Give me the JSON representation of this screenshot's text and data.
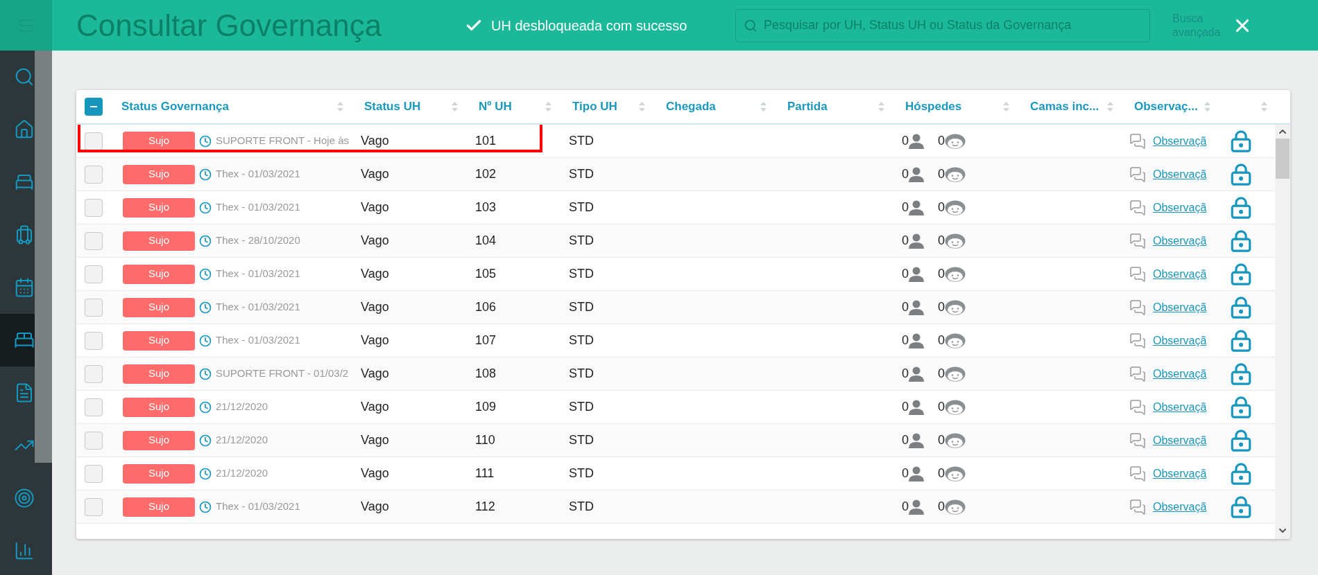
{
  "app_bar": {
    "title": "Consultar Governança",
    "search": {
      "placeholder": "Pesquisar por UH, Status UH ou Status da Governança"
    },
    "advanced_search": "Busca avançada"
  },
  "toast": {
    "message": "UH desbloqueada com sucesso"
  },
  "sidebar": {
    "items": [
      {
        "selected": false
      },
      {
        "selected": false
      },
      {
        "selected": false
      },
      {
        "selected": false
      },
      {
        "selected": false
      },
      {
        "selected": true
      },
      {
        "selected": false
      },
      {
        "selected": false
      },
      {
        "selected": false
      },
      {
        "selected": false
      }
    ]
  },
  "table": {
    "select_all": {
      "indeterminate": true
    },
    "columns": [
      "Status Governança",
      "Status UH",
      "Nº UH",
      "Tipo UH",
      "Chegada",
      "Partida",
      "Hóspedes",
      "Camas inc...",
      "Observaç..."
    ],
    "rows": [
      {
        "checked": false,
        "highlighted": true,
        "status": "Sujo",
        "note": "SUPORTE FRONT - Hoje às",
        "uh_status": "Vago",
        "number": "101",
        "type": "STD",
        "adults": "0",
        "children": "0",
        "observation": "Observaçã",
        "locked": true
      },
      {
        "checked": false,
        "highlighted": false,
        "status": "Sujo",
        "note": "Thex - 01/03/2021",
        "uh_status": "Vago",
        "number": "102",
        "type": "STD",
        "adults": "0",
        "children": "0",
        "observation": "Observaçã",
        "locked": true
      },
      {
        "checked": false,
        "highlighted": false,
        "status": "Sujo",
        "note": "Thex - 01/03/2021",
        "uh_status": "Vago",
        "number": "103",
        "type": "STD",
        "adults": "0",
        "children": "0",
        "observation": "Observaçã",
        "locked": true
      },
      {
        "checked": false,
        "highlighted": false,
        "status": "Sujo",
        "note": "Thex - 28/10/2020",
        "uh_status": "Vago",
        "number": "104",
        "type": "STD",
        "adults": "0",
        "children": "0",
        "observation": "Observaçã",
        "locked": true
      },
      {
        "checked": false,
        "highlighted": false,
        "status": "Sujo",
        "note": "Thex - 01/03/2021",
        "uh_status": "Vago",
        "number": "105",
        "type": "STD",
        "adults": "0",
        "children": "0",
        "observation": "Observaçã",
        "locked": true
      },
      {
        "checked": false,
        "highlighted": false,
        "status": "Sujo",
        "note": "Thex - 01/03/2021",
        "uh_status": "Vago",
        "number": "106",
        "type": "STD",
        "adults": "0",
        "children": "0",
        "observation": "Observaçã",
        "locked": true
      },
      {
        "checked": false,
        "highlighted": false,
        "status": "Sujo",
        "note": "Thex - 01/03/2021",
        "uh_status": "Vago",
        "number": "107",
        "type": "STD",
        "adults": "0",
        "children": "0",
        "observation": "Observaçã",
        "locked": true
      },
      {
        "checked": false,
        "highlighted": false,
        "status": "Sujo",
        "note": "SUPORTE FRONT - 01/03/2",
        "uh_status": "Vago",
        "number": "108",
        "type": "STD",
        "adults": "0",
        "children": "0",
        "observation": "Observaçã",
        "locked": true
      },
      {
        "checked": false,
        "highlighted": false,
        "status": "Sujo",
        "note": "21/12/2020",
        "uh_status": "Vago",
        "number": "109",
        "type": "STD",
        "adults": "0",
        "children": "0",
        "observation": "Observaçã",
        "locked": true
      },
      {
        "checked": false,
        "highlighted": false,
        "status": "Sujo",
        "note": "21/12/2020",
        "uh_status": "Vago",
        "number": "110",
        "type": "STD",
        "adults": "0",
        "children": "0",
        "observation": "Observaçã",
        "locked": true
      },
      {
        "checked": false,
        "highlighted": false,
        "status": "Sujo",
        "note": "21/12/2020",
        "uh_status": "Vago",
        "number": "111",
        "type": "STD",
        "adults": "0",
        "children": "0",
        "observation": "Observaçã",
        "locked": true
      },
      {
        "checked": false,
        "highlighted": false,
        "status": "Sujo",
        "note": "Thex - 01/03/2021",
        "uh_status": "Vago",
        "number": "112",
        "type": "STD",
        "adults": "0",
        "children": "0",
        "observation": "Observaçã",
        "locked": true
      }
    ]
  }
}
